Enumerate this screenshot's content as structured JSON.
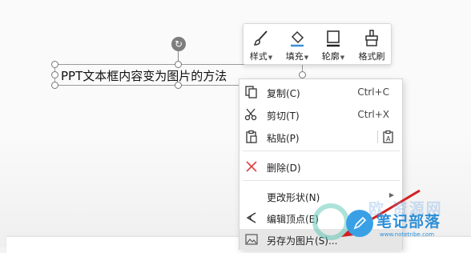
{
  "textbox": {
    "text": "PPT文本框内容变为图片的方法"
  },
  "toolbar": {
    "items": [
      {
        "label": "样式",
        "has_dropdown": true,
        "icon": "brush-icon"
      },
      {
        "label": "填充",
        "has_dropdown": true,
        "icon": "fill-bucket-icon"
      },
      {
        "label": "轮廓",
        "has_dropdown": true,
        "icon": "outline-icon"
      },
      {
        "label": "格式刷",
        "has_dropdown": false,
        "icon": "format-painter-icon"
      }
    ]
  },
  "menu": {
    "items": [
      {
        "label": "复制(C)",
        "shortcut": "Ctrl+C",
        "icon": "copy-icon"
      },
      {
        "label": "剪切(T)",
        "shortcut": "Ctrl+X",
        "icon": "scissors-icon"
      },
      {
        "label": "粘贴(P)",
        "shortcut": "",
        "icon": "paste-icon"
      },
      {
        "label": "删除(D)",
        "shortcut": "",
        "icon": "delete-x-icon"
      },
      {
        "label": "更改形状(N)",
        "shortcut": "",
        "icon": ""
      },
      {
        "label": "编辑顶点(E)",
        "shortcut": "",
        "icon": "edit-points-icon"
      },
      {
        "label": "另存为图片(S)...",
        "shortcut": "",
        "icon": "save-as-picture-icon"
      }
    ]
  },
  "watermark": {
    "title": "笔记部落",
    "url": "www.notetribe.com",
    "faint": "欧 资源网"
  },
  "colors": {
    "accent": "#2d8fd8",
    "delete_red": "#e04040",
    "arrow_red": "#d42020"
  }
}
